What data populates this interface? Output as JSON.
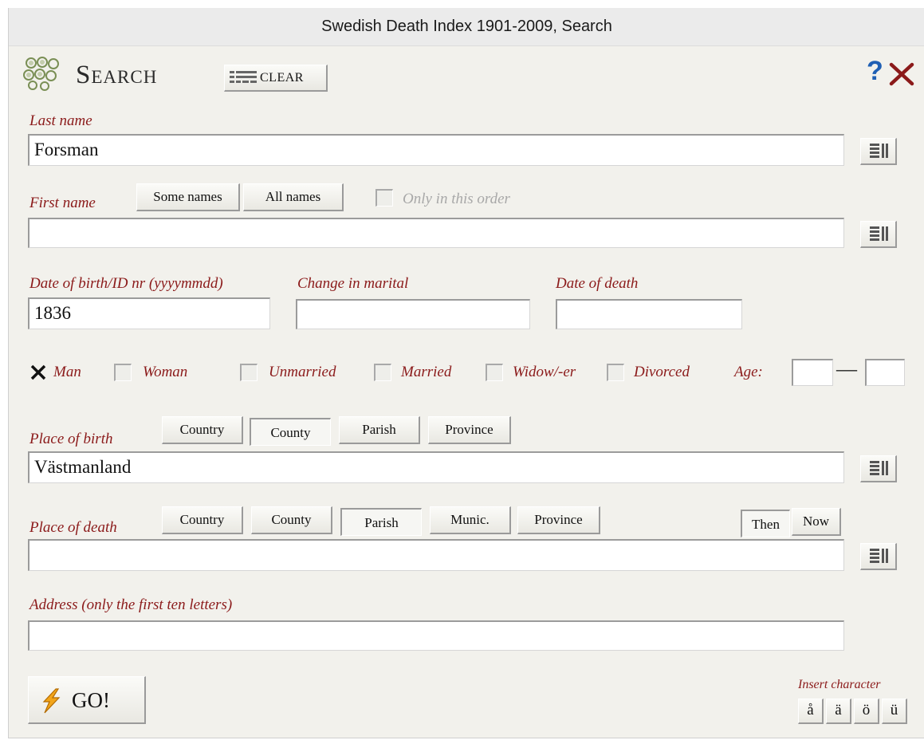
{
  "window": {
    "title": "Swedish Death Index 1901-2009, Search"
  },
  "header": {
    "title": "Search",
    "clear_label": "CLEAR",
    "help_label": "?",
    "close_label": "×"
  },
  "last_name": {
    "label": "Last name",
    "value": "Forsman"
  },
  "first_name": {
    "label": "First name",
    "some_names": "Some names",
    "all_names": "All names",
    "only_in_order": "Only in this order",
    "value": ""
  },
  "dates": {
    "birth_label": "Date of birth/ID nr (yyyymmdd)",
    "birth_value": "1836",
    "marital_label": "Change in marital",
    "marital_value": "",
    "death_label": "Date of death",
    "death_value": ""
  },
  "checkboxes": {
    "man": "Man",
    "man_checked": "✕",
    "woman": "Woman",
    "unmarried": "Unmarried",
    "married": "Married",
    "widow": "Widow/-er",
    "divorced": "Divorced",
    "age": "Age:",
    "age_dash": "—"
  },
  "place_of_birth": {
    "label": "Place of birth",
    "country": "Country",
    "county": "County",
    "parish": "Parish",
    "province": "Province",
    "value": "Västmanland"
  },
  "place_of_death": {
    "label": "Place of death",
    "country": "Country",
    "county": "County",
    "parish": "Parish",
    "munic": "Munic.",
    "province": "Province",
    "then": "Then",
    "now": "Now",
    "value": ""
  },
  "address": {
    "label": "Address (only the first ten letters)",
    "value": ""
  },
  "footer": {
    "go_label": "GO!",
    "insert_label": "Insert character",
    "chars": [
      "å",
      "ä",
      "ö",
      "ü"
    ]
  },
  "colors": {
    "label": "#8b1a1a",
    "help": "#1f5fb4",
    "close": "#8b1a1a"
  }
}
